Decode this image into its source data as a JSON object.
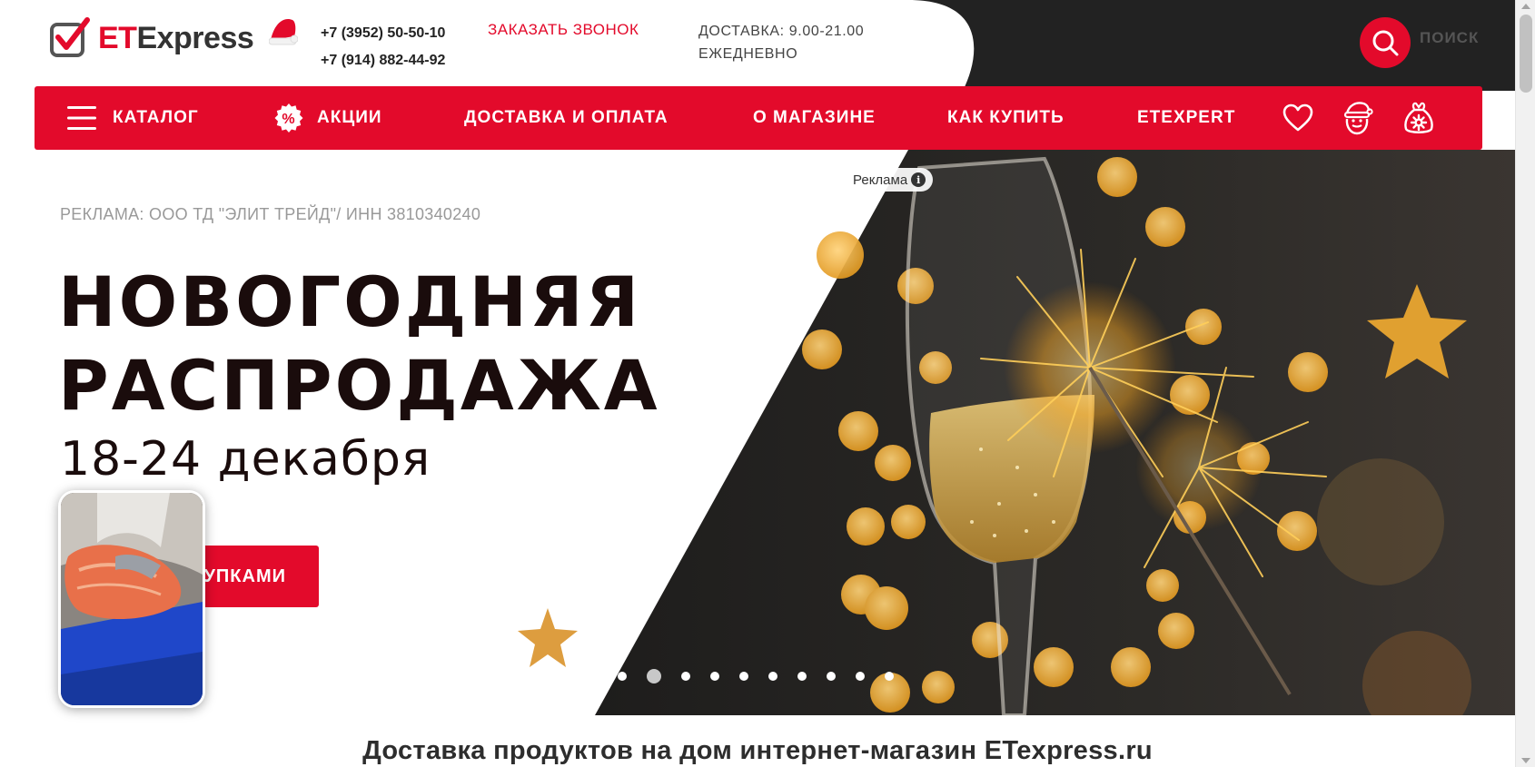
{
  "header": {
    "logo": {
      "et": "ET",
      "express": "Express"
    },
    "phones": [
      "+7 (3952) 50-50-10",
      "+7 (914) 882-44-92"
    ],
    "callback_label": "ЗАКАЗАТЬ ЗВОНОК",
    "delivery_line1": "ДОСТАВКА: 9.00-21.00",
    "delivery_line2": "ЕЖЕДНЕВНО",
    "search_label": "ПОИСК"
  },
  "nav": {
    "items": [
      {
        "label": "КАТАЛОГ",
        "icon": "hamburger-icon"
      },
      {
        "label": "АКЦИИ",
        "icon": "percent-icon",
        "icon_text": "%"
      },
      {
        "label": "ДОСТАВКА И ОПЛАТА"
      },
      {
        "label": "О МАГАЗИНЕ"
      },
      {
        "label": "КАК КУПИТЬ"
      },
      {
        "label": "ETEXPERT"
      }
    ],
    "icons": [
      "heart-icon",
      "santa-user-icon",
      "gift-bag-icon"
    ]
  },
  "hero": {
    "ad_badge": "Реклама",
    "ad_badge_icon": "i",
    "ad_note": "РЕКЛАМА: ООО ТД \"ЭЛИТ ТРЕЙД\"/ ИНН 3810340240",
    "title_line1": "НОВОГОДНЯЯ",
    "title_line2": "РАСПРОДАЖА",
    "dates": "18-24 декабря",
    "cta_label": "УПКАМИ",
    "slide_count": 10,
    "active_slide": 2
  },
  "page_heading": "Доставка продуктов на дом интернет-магазин ETexpress.ru",
  "colors": {
    "brand_red": "#e30a2b",
    "dark_bg": "#222222",
    "text_dark": "#1a0c0c"
  }
}
